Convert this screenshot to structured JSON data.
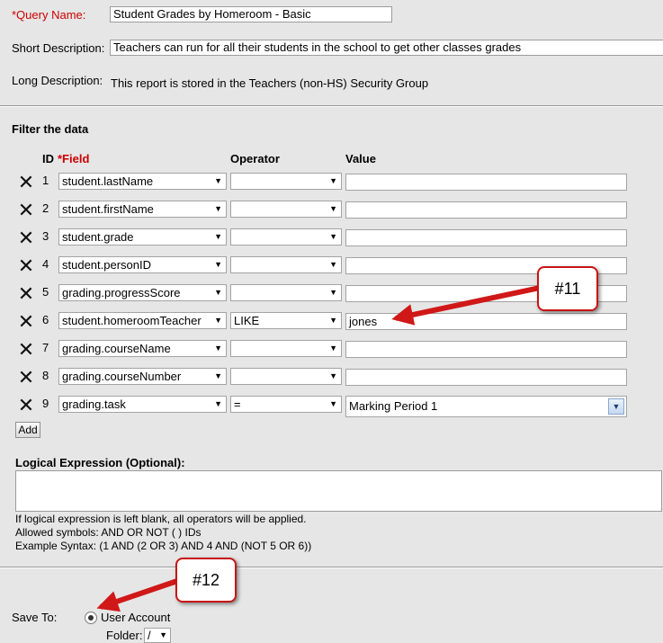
{
  "header": {
    "query_name_label": "*Query Name:",
    "query_name_value": "Student Grades by Homeroom - Basic",
    "short_desc_label": "Short Description:",
    "short_desc_value": "Teachers can run for all their students in the school to get other classes grades",
    "long_desc_label": "Long Description:",
    "long_desc_value": "This report is stored in the Teachers (non-HS) Security Group"
  },
  "filter": {
    "title": "Filter the data",
    "col_id": "ID",
    "col_field": "*Field",
    "col_operator": "Operator",
    "col_value": "Value",
    "rows": [
      {
        "id": "1",
        "field": "student.lastName",
        "operator": "",
        "value": ""
      },
      {
        "id": "2",
        "field": "student.firstName",
        "operator": "",
        "value": ""
      },
      {
        "id": "3",
        "field": "student.grade",
        "operator": "",
        "value": ""
      },
      {
        "id": "4",
        "field": "student.personID",
        "operator": "",
        "value": ""
      },
      {
        "id": "5",
        "field": "grading.progressScore",
        "operator": "",
        "value": ""
      },
      {
        "id": "6",
        "field": "student.homeroomTeacher",
        "operator": "LIKE",
        "value": "jones"
      },
      {
        "id": "7",
        "field": "grading.courseName",
        "operator": "",
        "value": ""
      },
      {
        "id": "8",
        "field": "grading.courseNumber",
        "operator": "",
        "value": ""
      },
      {
        "id": "9",
        "field": "grading.task",
        "operator": "=",
        "value": "Marking Period 1"
      }
    ],
    "add_label": "Add"
  },
  "logical": {
    "title": "Logical Expression (Optional):",
    "value": "",
    "help1": "If logical expression is left blank, all operators will be applied.",
    "help2": "Allowed symbols: AND OR NOT ( ) IDs",
    "help3": "Example Syntax: (1 AND (2 OR 3) AND 4 AND (NOT 5 OR 6))"
  },
  "save": {
    "label": "Save To:",
    "option": "User Account",
    "folder_label": "Folder:",
    "folder_value": "/"
  },
  "callouts": {
    "c11": "#11",
    "c12": "#12"
  },
  "colors": {
    "background": "#e6e6e6",
    "required": "#cc0000",
    "callout_border": "#c81414",
    "arrow": "#d01818"
  }
}
